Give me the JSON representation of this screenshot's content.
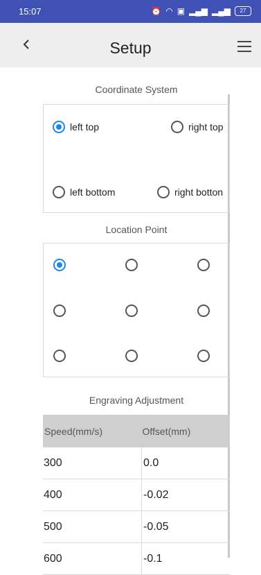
{
  "status": {
    "time": "15:07",
    "battery": "27"
  },
  "header": {
    "title": "Setup"
  },
  "coordinate": {
    "title": "Coordinate System",
    "options": [
      "left top",
      "right top",
      "left bottom",
      "right botton"
    ],
    "selected": "left top"
  },
  "location": {
    "title": "Location Point",
    "selected_index": 0,
    "count": 9
  },
  "adjustment": {
    "title": "Engraving Adjustment",
    "headers": [
      "Speed(mm/s)",
      "Offset(mm)"
    ],
    "rows": [
      [
        "300",
        "0.0"
      ],
      [
        "400",
        "-0.02"
      ],
      [
        "500",
        "-0.05"
      ],
      [
        "600",
        "-0.1"
      ]
    ]
  },
  "colors": {
    "statusbar": "#3f51b5",
    "appbar": "#eeeeee",
    "accent": "#1e88e5",
    "table_header": "#cfcfcf"
  }
}
